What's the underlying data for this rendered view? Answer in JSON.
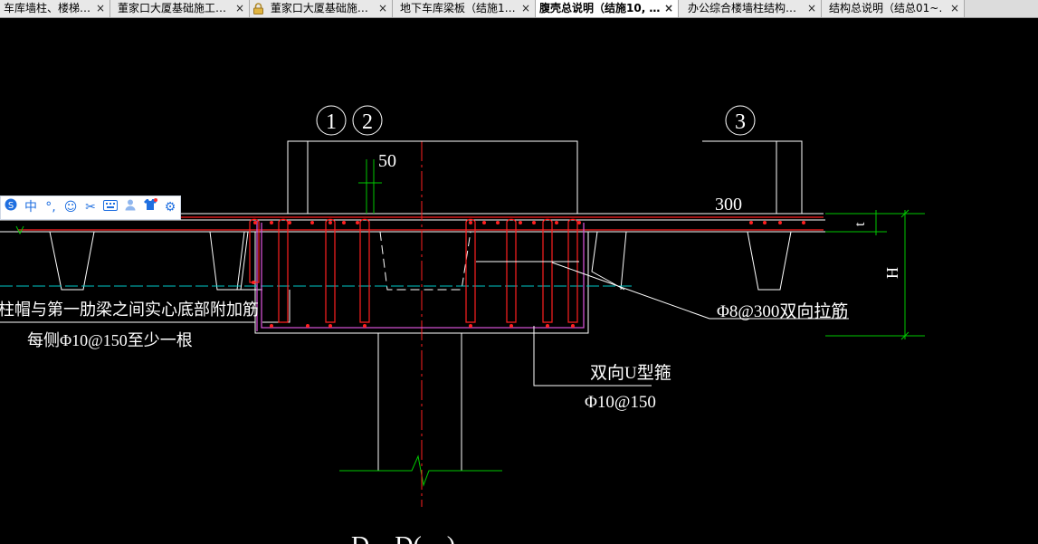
{
  "tabs": [
    {
      "label": "车库墙柱、楼梯…",
      "active": false,
      "locked": false
    },
    {
      "label": "董家口大厦基础施工…",
      "active": false,
      "locked": false
    },
    {
      "label": "董家口大厦基础施…",
      "active": false,
      "locked": true
    },
    {
      "label": "地下车库梁板（结施1…",
      "active": false,
      "locked": false
    },
    {
      "label": "腹壳总说明（结施10, …",
      "active": true,
      "locked": false
    },
    {
      "label": "办公综合楼墙柱结构…",
      "active": false,
      "locked": false
    },
    {
      "label": "结构总说明（结总01~…",
      "active": false,
      "locked": false
    }
  ],
  "close_symbol": "×",
  "ime_toolbar": {
    "items": [
      "ime-logo-icon",
      "chinese-mode",
      "punctuation-icon",
      "emoji-icon",
      "scissors-icon",
      "keyboard-icon",
      "user-icon",
      "skin-icon",
      "settings-icon"
    ],
    "chinese_label": "中"
  },
  "drawing": {
    "markers": [
      "1",
      "2",
      "3"
    ],
    "dim_50": "50",
    "dim_300": "300",
    "dim_t": "t",
    "dim_H": "H",
    "note_left_line1": "柱帽与第一肋梁之间实心底部附加筋",
    "note_left_line2": "每侧Φ10@150至少一根",
    "note_tie": "Φ8@300双向拉筋",
    "note_stirrup_line1": "双向U型箍",
    "note_stirrup_line2": "Φ10@150",
    "section_title": "D—D(…)"
  },
  "colors": {
    "background": "#000000",
    "white_line": "#ffffff",
    "red_rebar": "#ff2020",
    "magenta_rebar": "#d050d0",
    "green_dim": "#00c800",
    "cyan_axis": "#00c8c8",
    "ime_blue": "#1f6fe0"
  }
}
